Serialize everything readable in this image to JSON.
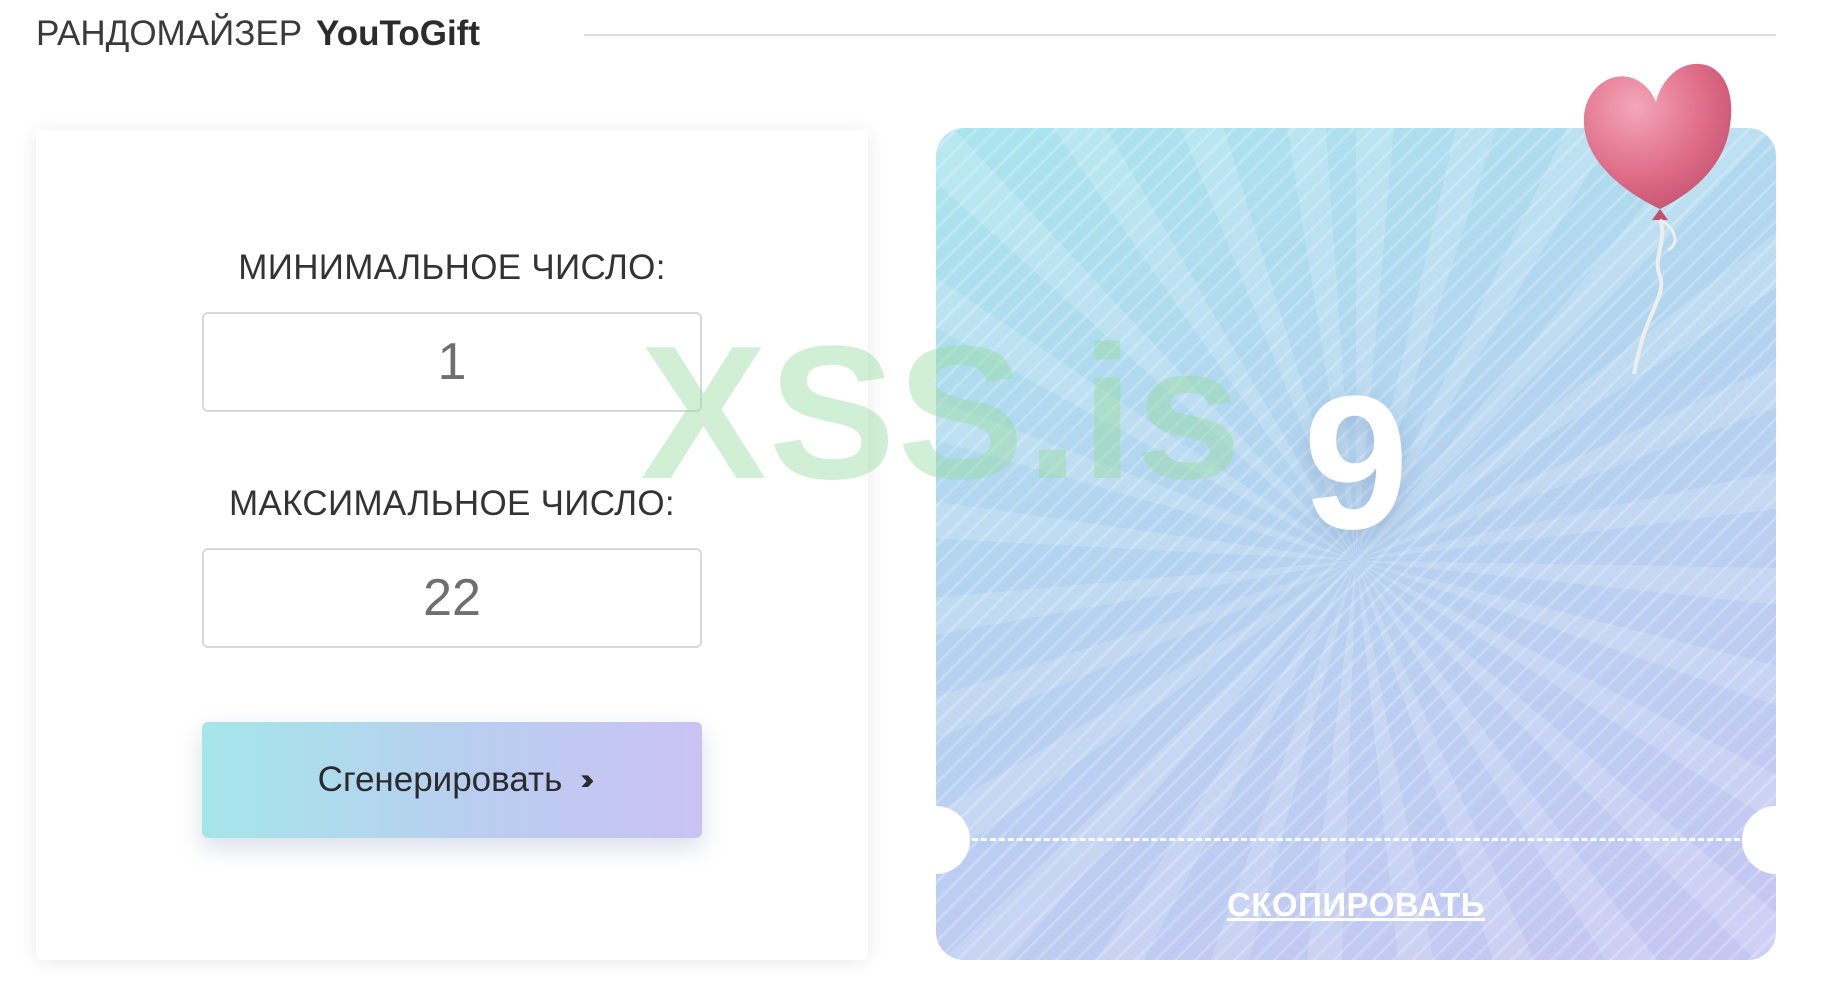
{
  "header": {
    "title_prefix": "РАНДОМАЙЗЕР",
    "title_brand": "YouToGift"
  },
  "form": {
    "min_label": "МИНИМАЛЬНОЕ ЧИСЛО:",
    "min_value": "1",
    "max_label": "МАКСИМАЛЬНОЕ ЧИСЛО:",
    "max_value": "22",
    "generate_label": "Сгенерировать",
    "generate_icon": "triple-chevron-right-icon"
  },
  "result": {
    "number": "9",
    "copy_label": "СКОПИРОВАТЬ",
    "decoration": "heart-balloon-icon"
  },
  "watermark": {
    "text": "XSS.is"
  },
  "colors": {
    "button_gradient": [
      "#a5e6ea",
      "#cbc2f4"
    ],
    "card_gradient": [
      "#a9e5ee",
      "#c6c6f3"
    ],
    "balloon": "#e1708b"
  }
}
